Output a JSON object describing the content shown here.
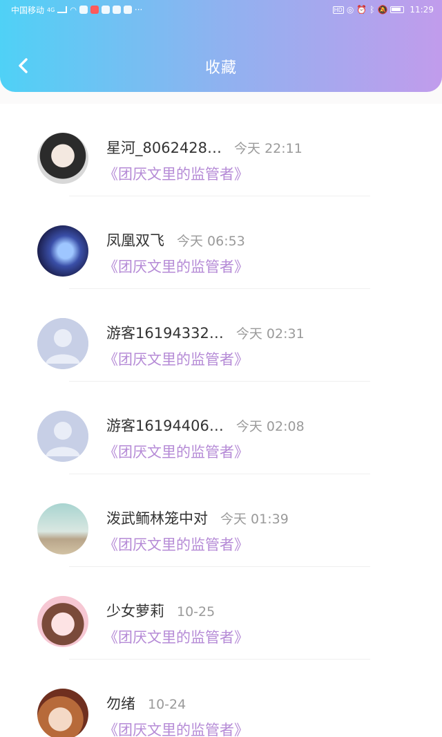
{
  "statusbar": {
    "carrier": "中国移动",
    "network": "4G",
    "more": "···",
    "time": "11:29",
    "hd": "HD"
  },
  "header": {
    "title": "收藏",
    "back_icon": "chevron-left-icon",
    "colors": {
      "gradient_start": "#4fd1f6",
      "gradient_end": "#c19cec"
    }
  },
  "items": [
    {
      "name": "星河_8062428…",
      "time": "今天 22:11",
      "subject": "《团厌文里的监管者》"
    },
    {
      "name": "凤凰双飞",
      "time": "今天 06:53",
      "subject": "《团厌文里的监管者》"
    },
    {
      "name": "游客16194332…",
      "time": "今天 02:31",
      "subject": "《团厌文里的监管者》"
    },
    {
      "name": "游客16194406…",
      "time": "今天 02:08",
      "subject": "《团厌文里的监管者》"
    },
    {
      "name": "泼武鲕林笼中对",
      "time": "今天 01:39",
      "subject": "《团厌文里的监管者》"
    },
    {
      "name": "少女萝莉",
      "time": "10-25",
      "subject": "《团厌文里的监管者》"
    },
    {
      "name": "勿绪",
      "time": "10-24",
      "subject": "《团厌文里的监管者》"
    }
  ]
}
